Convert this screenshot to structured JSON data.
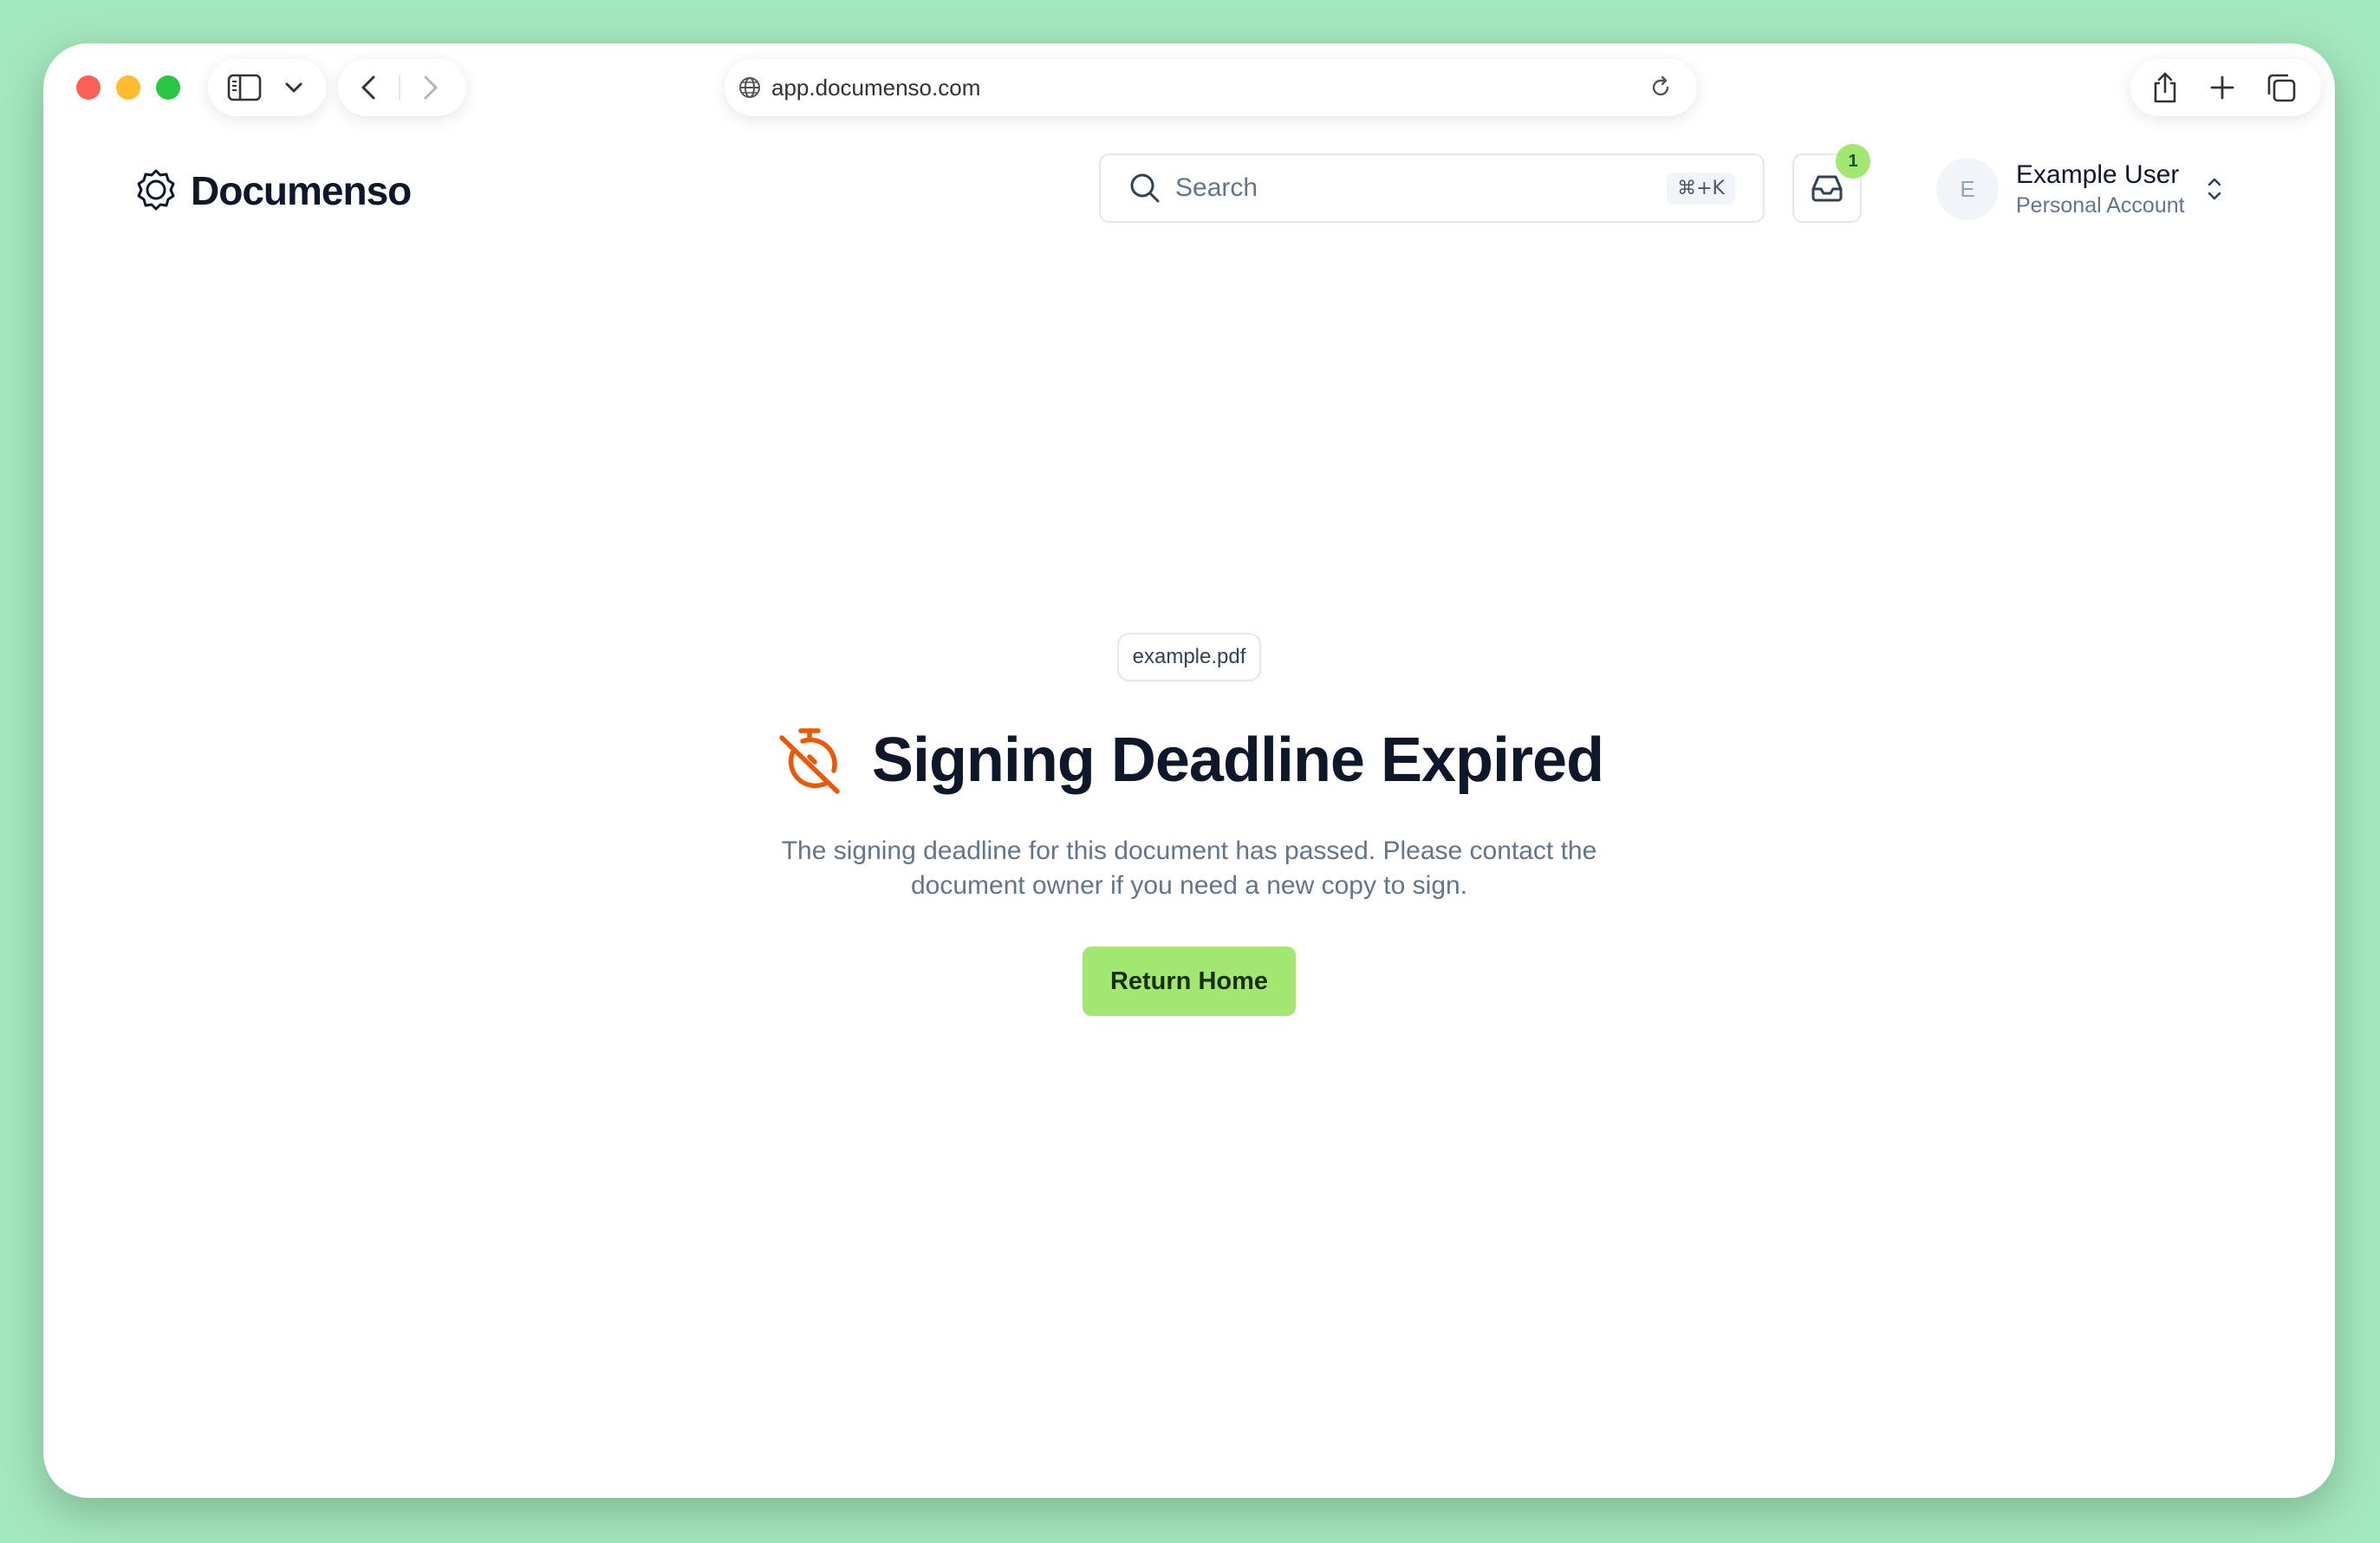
{
  "browser": {
    "url": "app.documenso.com"
  },
  "header": {
    "brand": "Documenso",
    "search_placeholder": "Search",
    "search_shortcut": "⌘+K",
    "inbox_badge": "1",
    "avatar_initial": "E",
    "user_name": "Example User",
    "account_type": "Personal Account"
  },
  "main": {
    "file_name": "example.pdf",
    "title": "Signing Deadline Expired",
    "description": "The signing deadline for this document has passed. Please contact the document owner if you need a new copy to sign.",
    "button_label": "Return Home"
  },
  "colors": {
    "background": "#a3e7bd",
    "accent": "#a2e771",
    "warning_icon": "#ea580c",
    "heading": "#0f172a"
  },
  "icons": {
    "title": "timer-off-icon",
    "inbox": "inbox-icon",
    "search": "search-icon",
    "logo": "badge-logo-icon"
  }
}
